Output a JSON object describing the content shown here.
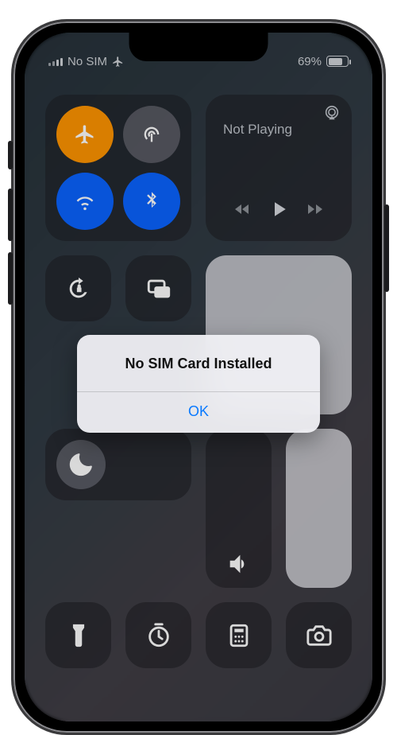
{
  "status": {
    "carrier": "No SIM",
    "battery_pct": "69%"
  },
  "media": {
    "not_playing": "Not Playing"
  },
  "alert": {
    "title": "No SIM Card Installed",
    "ok": "OK"
  },
  "icons": {
    "airplane": "airplane-icon",
    "antenna": "cellular-antenna-icon",
    "wifi": "wifi-icon",
    "bluetooth": "bluetooth-icon",
    "airplay": "airplay-icon",
    "rewind": "rewind-icon",
    "play": "play-icon",
    "forward": "fast-forward-icon",
    "lock_rotation": "rotation-lock-icon",
    "mirroring": "screen-mirroring-icon",
    "focus": "do-not-disturb-moon-icon",
    "flashlight": "flashlight-icon",
    "timer": "timer-icon",
    "calculator": "calculator-icon",
    "camera": "camera-icon",
    "brightness": "brightness-slider",
    "volume": "volume-slider"
  }
}
